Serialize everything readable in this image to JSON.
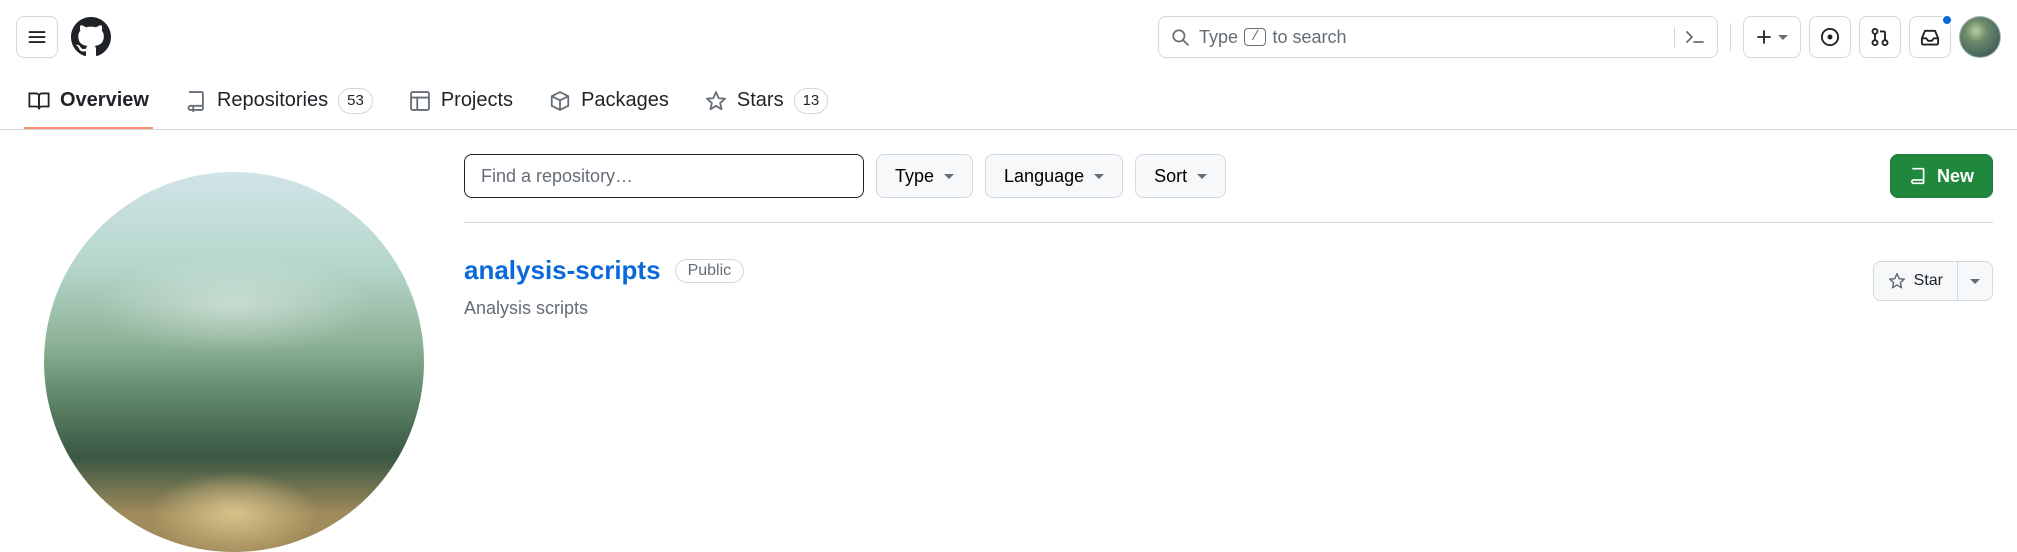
{
  "header": {
    "search": {
      "prefix": "Type",
      "shortcut": "/",
      "suffix": "to search"
    }
  },
  "tabs": {
    "overview": "Overview",
    "repositories": "Repositories",
    "repositories_count": "53",
    "projects": "Projects",
    "packages": "Packages",
    "stars": "Stars",
    "stars_count": "13"
  },
  "filters": {
    "find_placeholder": "Find a repository…",
    "type": "Type",
    "language": "Language",
    "sort": "Sort",
    "new": "New"
  },
  "repo": {
    "name": "analysis-scripts",
    "visibility": "Public",
    "description": "Analysis scripts",
    "star_label": "Star"
  }
}
